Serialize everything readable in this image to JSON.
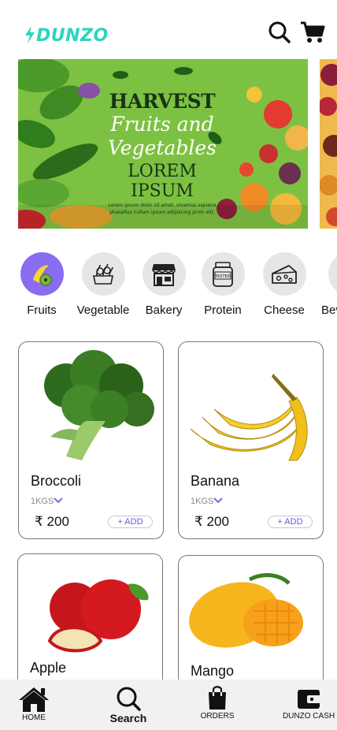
{
  "header": {
    "logo_text": "DUNZO",
    "search_icon": "search-icon",
    "cart_icon": "cart-icon"
  },
  "banner": {
    "heading": "HARVEST",
    "subheading_1": "Fruits and",
    "subheading_2": "Vegetables",
    "lorem": "LOREM IPSUM",
    "fine_print_1": "Lorem ipsum dolor sit amet, vivamus sapiene",
    "fine_print_2": "phasellus nullam ipsum adipiscing proin elit."
  },
  "categories": [
    {
      "label": "Fruits",
      "icon": "fruits-icon",
      "active": true
    },
    {
      "label": "Vegetable",
      "icon": "vegetable-icon"
    },
    {
      "label": "Bakery",
      "icon": "bakery-icon"
    },
    {
      "label": "Protein",
      "icon": "protein-jar-icon",
      "icon_text": "PROTEIN"
    },
    {
      "label": "Cheese",
      "icon": "cheese-icon"
    },
    {
      "label": "Bev",
      "icon": "beverage-icon"
    }
  ],
  "products": [
    {
      "name": "Broccoli",
      "weight": "1KGS",
      "price": "₹ 200",
      "add_label": "+ ADD"
    },
    {
      "name": "Banana",
      "weight": "1KGS",
      "price": "₹ 200",
      "add_label": "+ ADD"
    },
    {
      "name": "Apple"
    },
    {
      "name": "Mango"
    }
  ],
  "bottom_nav": [
    {
      "label": "HOME",
      "icon": "home-icon"
    },
    {
      "label": "Search",
      "icon": "search-icon"
    },
    {
      "label": "ORDERS",
      "icon": "shopping-bag-icon"
    },
    {
      "label": "DUNZO CASH",
      "icon": "wallet-icon"
    }
  ],
  "colors": {
    "brand": "#2ad4be",
    "accent": "#8a6cf0",
    "banner_bg": "#7dc142",
    "nav_bg": "#f1f1f1"
  }
}
